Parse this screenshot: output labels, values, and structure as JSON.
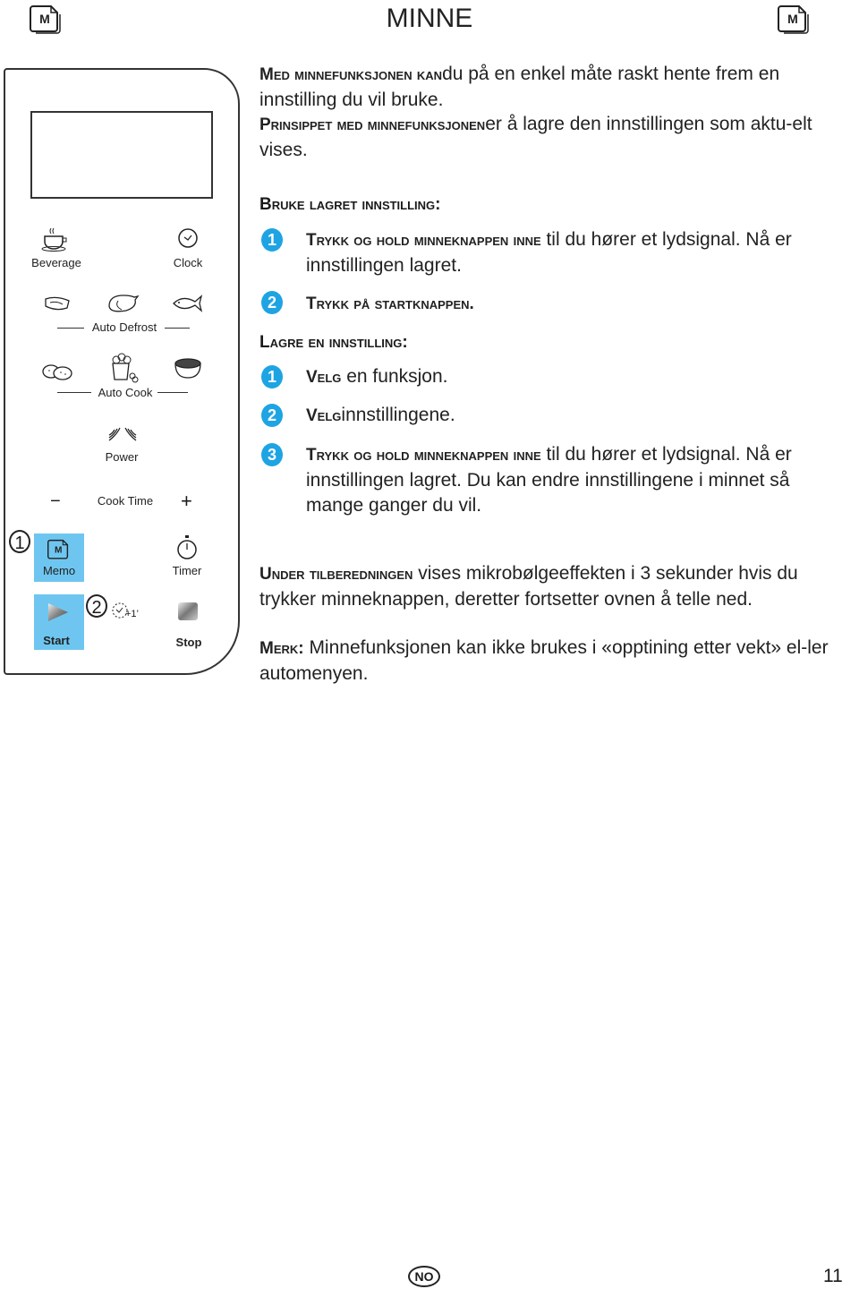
{
  "header": {
    "title": "MINNE",
    "left_icon": "memo-doc-icon",
    "right_icon": "memo-doc-icon",
    "icon_letter": "M"
  },
  "panel": {
    "buttons": [
      {
        "label": "Beverage",
        "icon": "coffee-cup-icon"
      },
      {
        "label": "Clock",
        "icon": "clock-icon"
      },
      {
        "label": "Auto Defrost",
        "icons": [
          "steak-icon",
          "chicken-icon",
          "fish-icon"
        ]
      },
      {
        "label": "Auto Cook",
        "icons": [
          "potato-icon",
          "popcorn-icon",
          "soup-bowl-icon"
        ]
      },
      {
        "label": "Power",
        "icon": "microwave-waves-icon"
      },
      {
        "label": "Cook Time",
        "minus": "−",
        "plus": "+"
      },
      {
        "label": "Memo",
        "icon": "memo-doc-icon",
        "highlighted": true,
        "callout": "1"
      },
      {
        "label": "Timer",
        "icon": "stopwatch-icon"
      },
      {
        "label": "Start",
        "icon": "play-icon",
        "highlighted": true,
        "callout": "2",
        "extra": "+1’"
      },
      {
        "label": "Stop",
        "icon": "stop-icon"
      }
    ]
  },
  "intro": {
    "p1_lead": "Med minnefunksjonen kan",
    "p1_rest": "du på en enkel måte raskt hente frem en innstilling du vil bruke.",
    "p2_lead": "Prinsippet med minnefunksjonen",
    "p2_rest": "er å lagre den innstillingen som aktu-elt vises."
  },
  "use_saved": {
    "heading": "Bruke lagret innstilling:",
    "steps": [
      {
        "num": "1",
        "lead": "Trykk og hold minneknappen inne",
        "rest": " til du hører et lydsignal. Nå er innstillingen lagret."
      },
      {
        "num": "2",
        "lead": "Trykk på startknappen.",
        "rest": ""
      }
    ]
  },
  "save_setting": {
    "heading": "Lagre en innstilling:",
    "steps": [
      {
        "num": "1",
        "lead": "Velg",
        "rest": " en funksjon."
      },
      {
        "num": "2",
        "lead": "Velg",
        "rest": "innstillingene."
      },
      {
        "num": "3",
        "lead": "Trykk og hold minneknappen inne",
        "rest": " til du hører et lydsignal. Nå er innstillingen lagret.  Du kan endre innstillingene i minnet så mange ganger du vil."
      }
    ]
  },
  "during": {
    "lead": "Under tilberedningen",
    "rest": " vises mikrobølgeeffekten i 3 sekunder hvis du trykker minneknappen, deretter fortsetter ovnen å telle ned."
  },
  "note": {
    "lead": "Merk:",
    "rest": "  Minnefunksjonen kan ikke brukes i «opptining etter vekt» el-ler automenyen."
  },
  "footer": {
    "language_badge": "NO",
    "page_number": "11"
  },
  "colors": {
    "accent_blue": "#1ea4e3",
    "highlight_blue": "#6ec6f0"
  }
}
